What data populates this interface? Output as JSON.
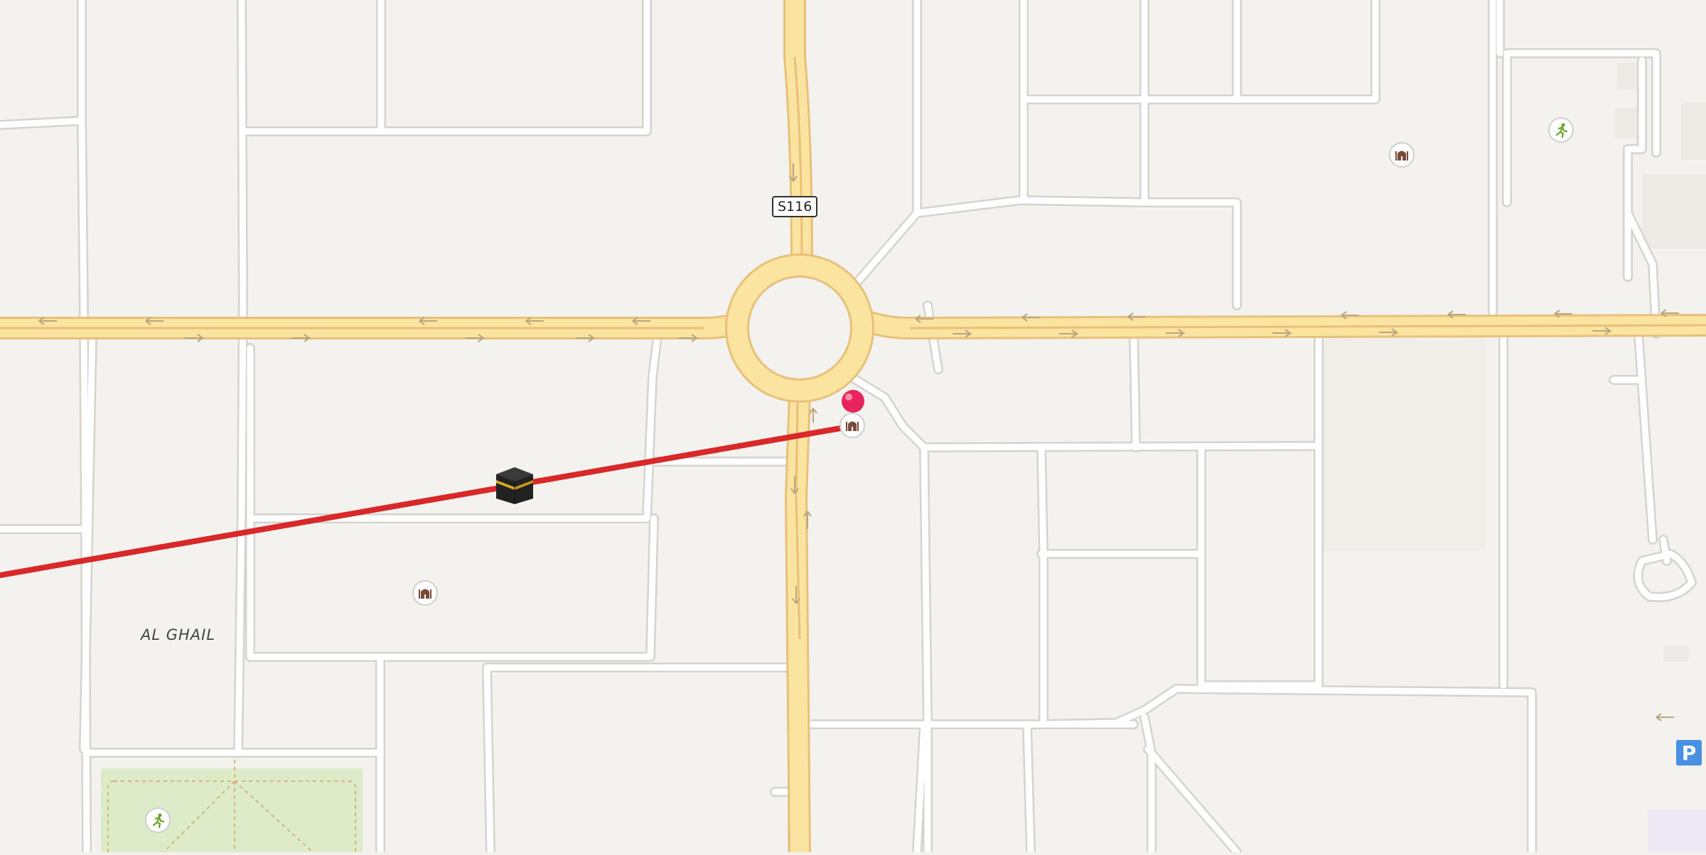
{
  "map": {
    "road_shield": "S116",
    "area_name": "AL GHAIL",
    "parking_label": "P",
    "colors": {
      "land": "#f4f2ef",
      "block": "#f6f4f1",
      "minor_road": "#ffffff",
      "minor_road_casing": "#d6d3cf",
      "major_road": "#fbe3a0",
      "major_road_casing": "#e8c07a",
      "park": "#dcebc8",
      "route_line": "#d8282a",
      "pin": "#e8245c",
      "building": "#ece8e3"
    },
    "icons": {
      "kaaba": "kaaba-icon",
      "pin": "location-pin-icon",
      "mosque": "mosque-icon",
      "sport": "running-icon",
      "parking": "parking-icon"
    }
  }
}
